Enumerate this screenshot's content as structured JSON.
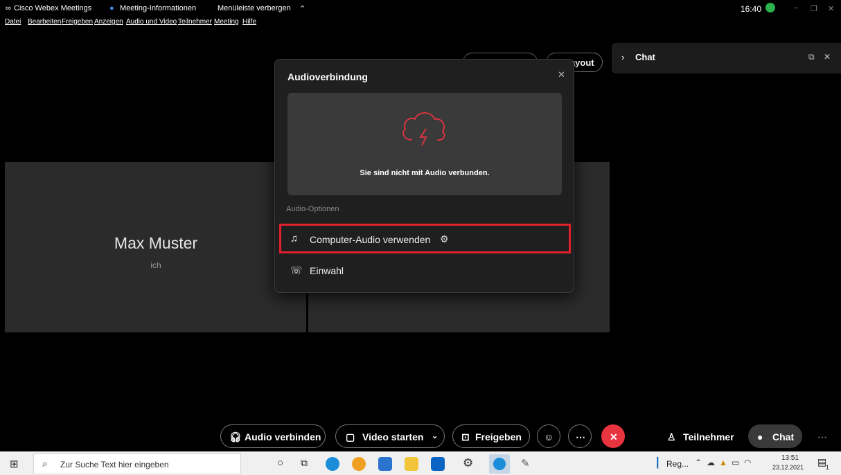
{
  "titlebar": {
    "app_name": "Cisco Webex Meetings",
    "meeting_info": "Meeting-Informationen",
    "hide_menu": "Menüleiste verbergen",
    "clock": "16:40"
  },
  "menu": [
    "Datei",
    "Bearbeiten",
    "Freigeben",
    "Anzeigen",
    "Audio und Video",
    "Teilnehmer",
    "Meeting",
    "Hilfe"
  ],
  "layout_button": "Layout",
  "chat_panel": {
    "title": "Chat"
  },
  "participant": {
    "name": "Max Muster",
    "subtitle": "ich"
  },
  "dialog": {
    "title": "Audioverbindung",
    "status_text": "Sie sind nicht mit Audio verbunden.",
    "options_label": "Audio-Optionen",
    "option_computer": "Computer-Audio verwenden",
    "option_dialin": "Einwahl"
  },
  "toolbar": {
    "audio": "Audio verbinden",
    "video": "Video starten",
    "share": "Freigeben",
    "participants": "Teilnehmer",
    "chat": "Chat"
  },
  "taskbar": {
    "search_placeholder": "Zur Suche Text hier eingeben",
    "tray_app": "Reg...",
    "time": "13:51",
    "date": "23.12.2021",
    "notification_count": "1"
  },
  "colors": {
    "accent_red": "#e0202c",
    "end_button": "#e8343f",
    "status_green": "#2bb24c"
  }
}
